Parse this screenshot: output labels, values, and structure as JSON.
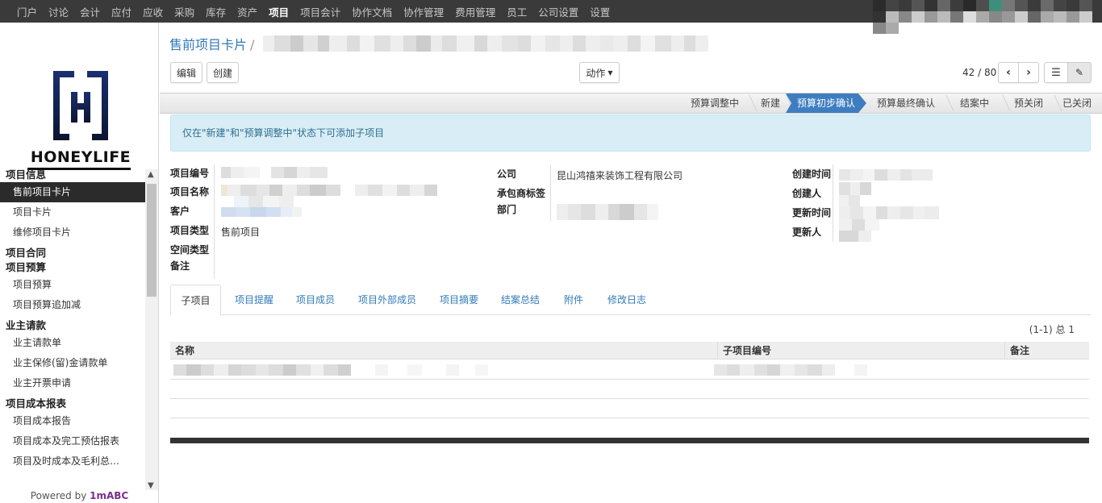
{
  "topnav": {
    "items": [
      "门户",
      "讨论",
      "会计",
      "应付",
      "应收",
      "采购",
      "库存",
      "资产",
      "项目",
      "项目会计",
      "协作文档",
      "协作管理",
      "费用管理",
      "员工",
      "公司设置",
      "设置"
    ],
    "active": "项目"
  },
  "logo": {
    "text": "HONEYLIFE"
  },
  "sidebar": {
    "sections": [
      {
        "title": "项目信息",
        "items": [
          "售前项目卡片",
          "项目卡片",
          "维修项目卡片"
        ]
      },
      {
        "title": "项目合同",
        "items": []
      },
      {
        "title": "项目预算",
        "items": [
          "项目预算",
          "项目预算追加减"
        ]
      },
      {
        "title": "业主请款",
        "items": [
          "业主请款单",
          "业主保修(留)金请款单",
          "业主开票申请"
        ]
      },
      {
        "title": "项目成本报表",
        "items": [
          "项目成本报告",
          "项目成本及完工预估报表",
          "项目及时成本及毛利总…"
        ]
      }
    ],
    "active_item": "售前项目卡片",
    "powered_by_prefix": "Powered by ",
    "powered_by_brand": "1mABC"
  },
  "breadcrumb": {
    "parent": "售前项目卡片",
    "separator": "/"
  },
  "toolbar": {
    "edit": "编辑",
    "create": "创建",
    "action": "动作",
    "pager": "42 / 80"
  },
  "stages": [
    "预算调整中",
    "新建",
    "预算初步确认",
    "预算最终确认",
    "结案中",
    "预关闭",
    "已关闭"
  ],
  "current_stage": "预算初步确认",
  "alert": "仅在\"新建\"和\"预算调整中\"状态下可添加子项目",
  "form": {
    "left_labels": [
      "项目编号",
      "项目名称",
      "客户",
      "项目类型",
      "空间类型",
      "备注"
    ],
    "project_type": "售前项目",
    "mid_labels": [
      "公司",
      "承包商标签",
      "部门"
    ],
    "company": "昆山鸿禧来装饰工程有限公司",
    "right_labels": [
      "创建时间",
      "创建人",
      "更新时间",
      "更新人"
    ]
  },
  "tabs": [
    "子项目",
    "项目提醒",
    "项目成员",
    "项目外部成员",
    "项目摘要",
    "结案总结",
    "附件",
    "修改日志"
  ],
  "active_tab": "子项目",
  "table": {
    "count": "(1-1) 总 1",
    "columns": [
      "名称",
      "子项目编号",
      "备注"
    ]
  },
  "colors": {
    "topbar": "#3a3a3a",
    "accent": "#337ab7",
    "stage_current": "#3e7ec0",
    "alert_bg": "#d9edf7"
  }
}
